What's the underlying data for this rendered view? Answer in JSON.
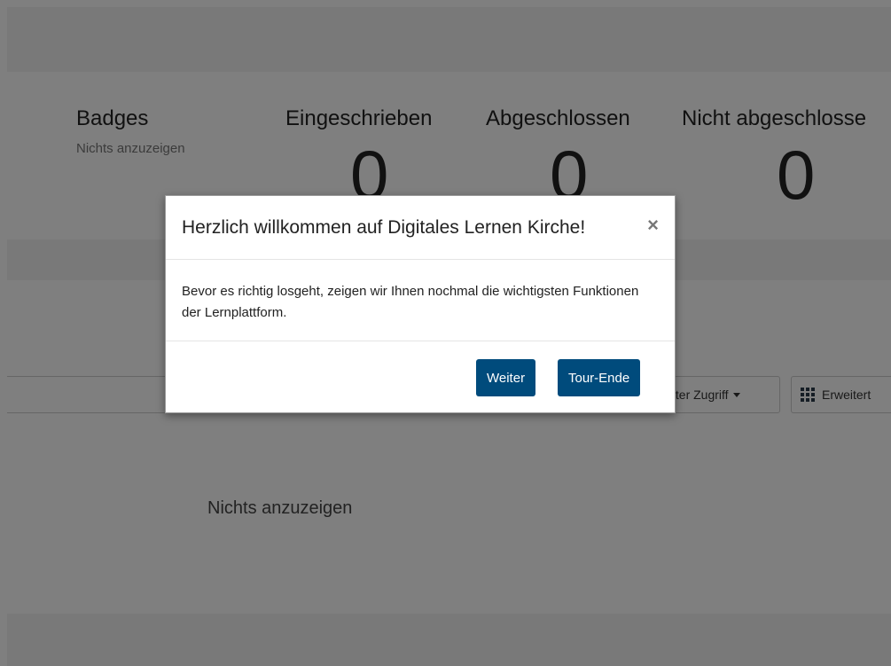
{
  "stats": {
    "badges": {
      "title": "Badges",
      "subtitle": "Nichts anzuzeigen"
    },
    "enrolled": {
      "title": "Eingeschrieben",
      "value": "0"
    },
    "completed": {
      "title": "Abgeschlossen",
      "value": "0"
    },
    "not_completed": {
      "title": "Nicht abgeschlosse",
      "value": "0"
    }
  },
  "toolbar": {
    "sort_label": "tzter Zugriff",
    "view_label": "Erweitert"
  },
  "main": {
    "empty_text": "Nichts anzuzeigen"
  },
  "modal": {
    "title": "Herzlich willkommen auf Digitales Lernen Kirche!",
    "close_glyph": "×",
    "body": "Bevor es richtig losgeht, zeigen wir Ihnen nochmal die wichtigsten Funktionen der Lernplattform.",
    "next_label": "Weiter",
    "end_label": "Tour-Ende"
  },
  "colors": {
    "primary": "#004b7c",
    "backdrop": "rgba(0,0,0,0.5)"
  },
  "icons": {
    "close": "close-icon",
    "sort_caret": "chevron-down-icon",
    "view": "grid-icon"
  }
}
